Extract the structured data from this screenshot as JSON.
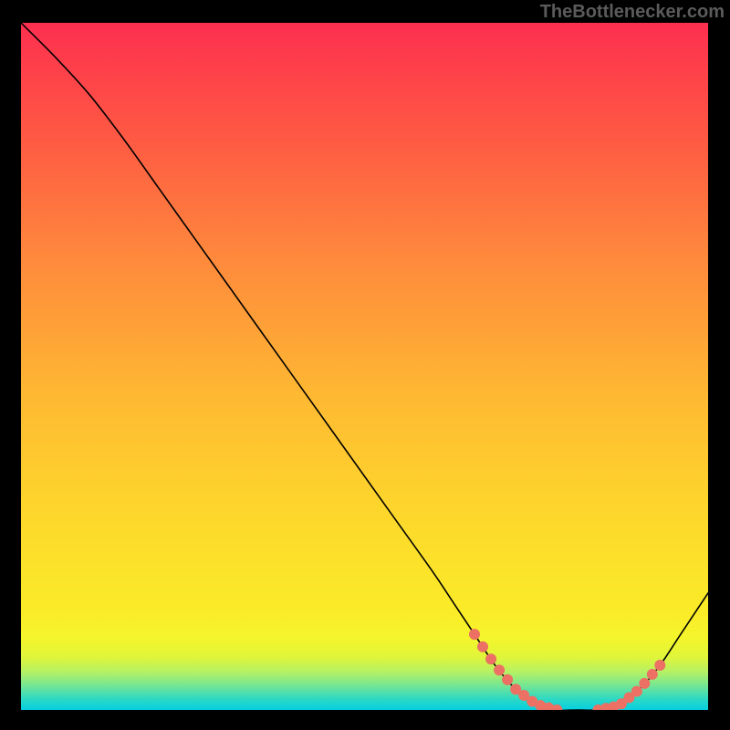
{
  "attribution": "TheBottlenecker.com",
  "chart_data": {
    "type": "line",
    "title": "",
    "xlabel": "",
    "ylabel": "",
    "xlim": [
      0,
      100
    ],
    "ylim": [
      0,
      100
    ],
    "series": [
      {
        "name": "bottleneck-curve",
        "x": [
          0,
          5,
          10,
          15,
          20,
          25,
          30,
          35,
          40,
          45,
          50,
          55,
          60,
          63,
          66,
          69,
          72,
          75,
          78,
          81,
          84,
          87,
          90,
          93,
          96,
          100
        ],
        "y": [
          100,
          95,
          89.5,
          83,
          76,
          69,
          62,
          55,
          48,
          41,
          34,
          27,
          20,
          15.5,
          11,
          6.5,
          3,
          0.8,
          0,
          0,
          0,
          0.6,
          3,
          6.5,
          11,
          17
        ]
      }
    ],
    "highlight_ranges": [
      {
        "name": "left-flank",
        "x_start": 66,
        "x_end": 78
      },
      {
        "name": "right-flank",
        "x_start": 84,
        "x_end": 93
      }
    ],
    "highlight_color": "#ec7063",
    "highlight_radius_px": 6,
    "background_gradient": {
      "top": "#fd2f4f",
      "mid1": "#fe8b3c",
      "mid2": "#fdd82b",
      "mid3": "#f8f427",
      "bottom_band_top": 0.895,
      "band": [
        {
          "stop": 0.895,
          "color": "#f5f52b"
        },
        {
          "stop": 0.923,
          "color": "#e0f53a"
        },
        {
          "stop": 0.945,
          "color": "#b4f165"
        },
        {
          "stop": 0.965,
          "color": "#73e695"
        },
        {
          "stop": 0.985,
          "color": "#2ad8c6"
        },
        {
          "stop": 1.0,
          "color": "#05d0e1"
        }
      ]
    }
  }
}
